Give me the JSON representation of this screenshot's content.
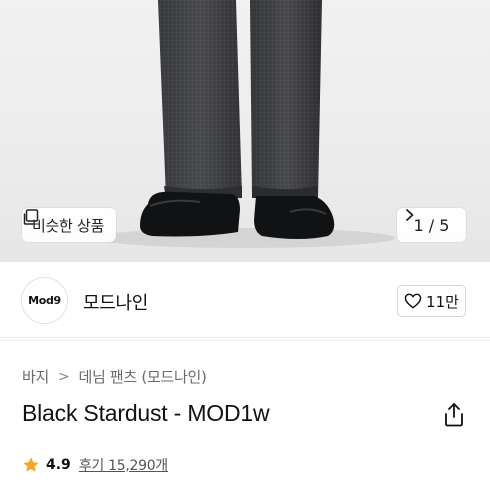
{
  "hero": {
    "similar_label": "비슷한 상품",
    "similar_icon": "similar-items-icon",
    "counter": "1 / 5",
    "next_icon": "chevron-right-icon"
  },
  "brand": {
    "logo_text": "Mod9",
    "name": "모드나인",
    "likes": "11만",
    "like_icon": "heart-outline-icon"
  },
  "breadcrumb": {
    "items": [
      "바지",
      "데님 팬츠 (모드나인)"
    ],
    "separator": ">"
  },
  "product": {
    "title": "Black Stardust - MOD1w",
    "share_icon": "share-icon"
  },
  "rating": {
    "score": "4.9",
    "reviews": "후기 15,290개",
    "star_color": "#F5A623"
  }
}
